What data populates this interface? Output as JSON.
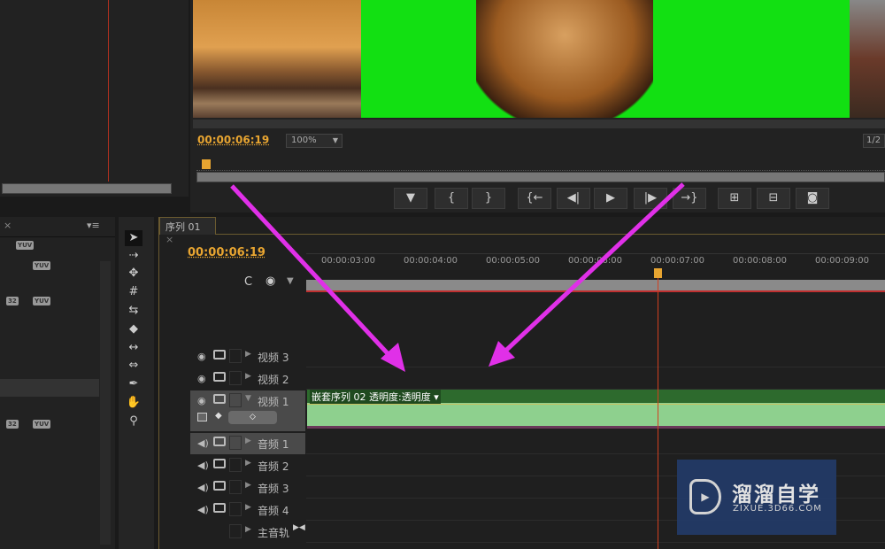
{
  "program_monitor": {
    "timecode": "00:00:06:19",
    "zoom": "100%",
    "resolution": "1/2"
  },
  "transport_buttons": [
    {
      "name": "add-marker",
      "glyph": "▼"
    },
    {
      "name": "mark-in",
      "glyph": "{"
    },
    {
      "name": "mark-out",
      "glyph": "}"
    },
    {
      "name": "go-to-in",
      "glyph": "{←"
    },
    {
      "name": "step-back",
      "glyph": "◀|"
    },
    {
      "name": "play",
      "glyph": "▶"
    },
    {
      "name": "step-forward",
      "glyph": "|▶"
    },
    {
      "name": "go-to-out",
      "glyph": "→}"
    },
    {
      "name": "lift",
      "glyph": "⊞"
    },
    {
      "name": "extract",
      "glyph": "⊟"
    },
    {
      "name": "export-frame",
      "glyph": "◙"
    }
  ],
  "sequence": {
    "tab": "序列 01",
    "close": "×",
    "timecode": "00:00:06:19"
  },
  "ruler_labels": [
    "00:00:03:00",
    "00:00:04:00",
    "00:00:05:00",
    "00:00:06:00",
    "00:00:07:00",
    "00:00:08:00",
    "00:00:09:00"
  ],
  "video_tracks": [
    "视频 3",
    "视频 2",
    "视频 1"
  ],
  "audio_tracks": [
    "音频 1",
    "音频 2",
    "音频 3",
    "音频 4"
  ],
  "master_track": "主音轨",
  "clip": {
    "label": "嵌套序列 02  透明度:透明度 ▾",
    "color": "#8ed08e"
  },
  "project_badges": [
    "YUV",
    "32"
  ],
  "watermark": {
    "title": "溜溜自学",
    "url": "ZIXUE.3D66.COM"
  },
  "colors": {
    "timecode": "#e8a531",
    "annotation_arrow": "#e030e8",
    "playhead": "#d04020",
    "chroma": "#11e010"
  }
}
